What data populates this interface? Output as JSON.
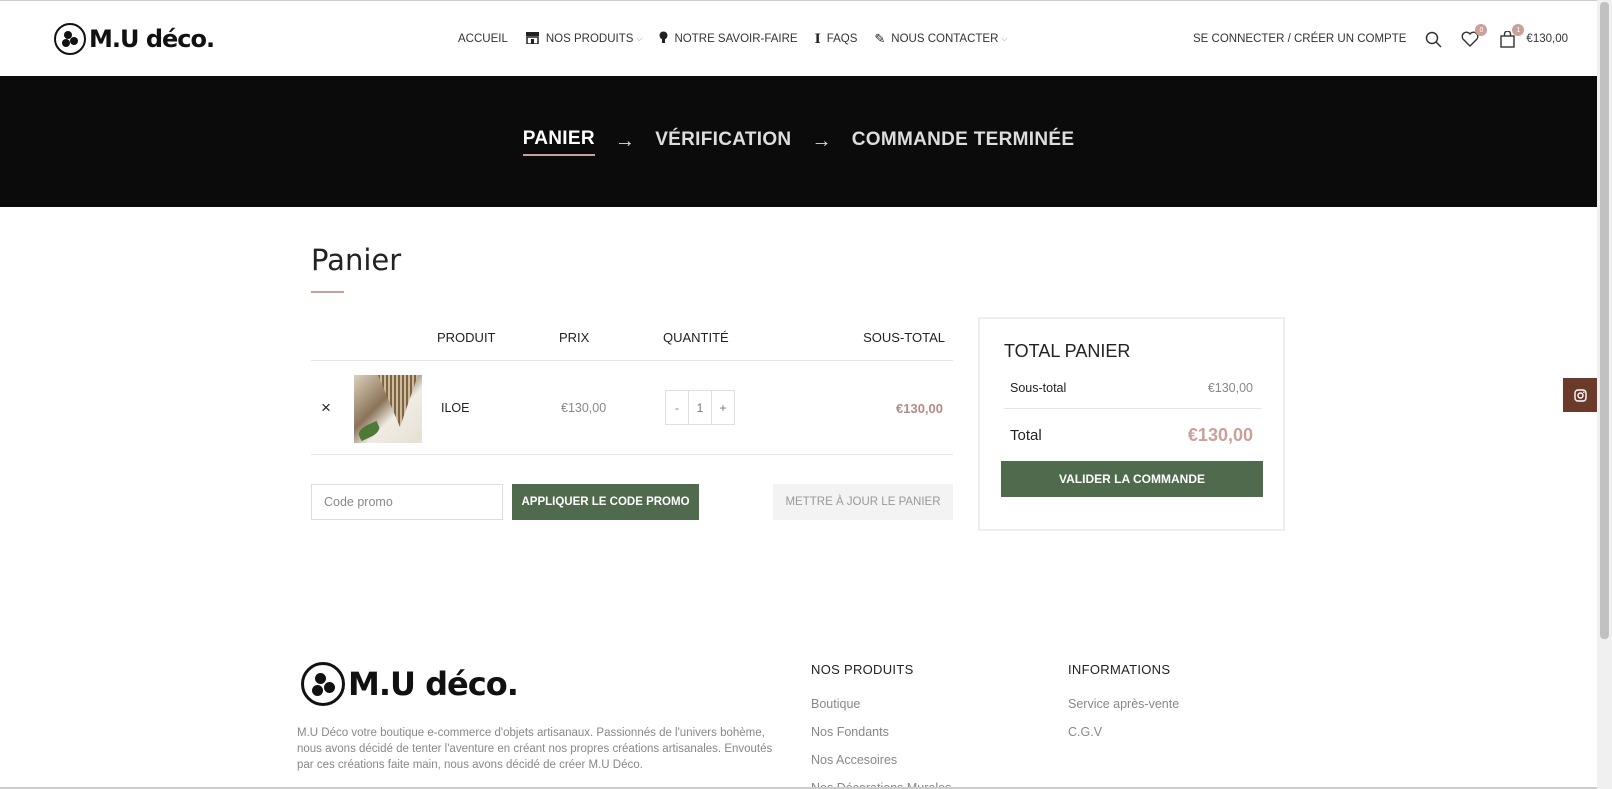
{
  "brand": {
    "name": "M.U déco."
  },
  "nav": {
    "items": [
      {
        "label": "Accueil",
        "icon": ""
      },
      {
        "label": "Nos produits",
        "icon": "store-icon",
        "dropdown": true
      },
      {
        "label": "Notre savoir-faire",
        "icon": "lightbulb-icon"
      },
      {
        "label": "FAQs",
        "icon": "info-icon"
      },
      {
        "label": "Nous contacter",
        "icon": "pencil-icon",
        "dropdown": true
      }
    ]
  },
  "header": {
    "login_label": "Se connecter / Créer un compte",
    "wishlist_count": "0",
    "cart_count": "1",
    "cart_total": "€130,00"
  },
  "steps": {
    "items": [
      "Panier",
      "Vérification",
      "Commande terminée"
    ],
    "active": "Panier"
  },
  "cart": {
    "title": "Panier",
    "columns": {
      "product": "Produit",
      "price": "Prix",
      "quantity": "Quantité",
      "subtotal": "Sous-total"
    },
    "rows": [
      {
        "name": "ILOE",
        "price": "€130,00",
        "quantity": "1",
        "subtotal": "€130,00"
      }
    ],
    "qty_minus": "-",
    "qty_plus": "+",
    "remove_symbol": "×",
    "coupon_placeholder": "Code promo",
    "apply_label": "Appliquer le code promo",
    "update_label": "Mettre à jour le panier"
  },
  "totals": {
    "title": "Total panier",
    "subtotal_label": "Sous-total",
    "subtotal_value": "€130,00",
    "total_label": "Total",
    "total_value": "€130,00",
    "checkout_label": "Valider la commande"
  },
  "footer": {
    "description": "M.U Déco votre boutique e-commerce d'objets artisanaux. Passionnés de l'univers bohème, nous avons décidé de tenter l'aventure en créant nos propres créations artisanales. Envoutés par ces créations faite main, nous avons décidé de créer M.U Déco.",
    "col1": {
      "title": "Nos produits",
      "links": [
        "Boutique",
        "Nos Fondants",
        "Nos Accesoires",
        "Nos Décorations Murales"
      ]
    },
    "col2": {
      "title": "Informations",
      "links": [
        "Service après-vente",
        "C.G.V"
      ]
    }
  },
  "colors": {
    "accent": "#c9a09a",
    "button_green": "#4f6a4d",
    "banner_bg": "#0b0b0b",
    "instagram_bg": "#6b3a2a"
  }
}
